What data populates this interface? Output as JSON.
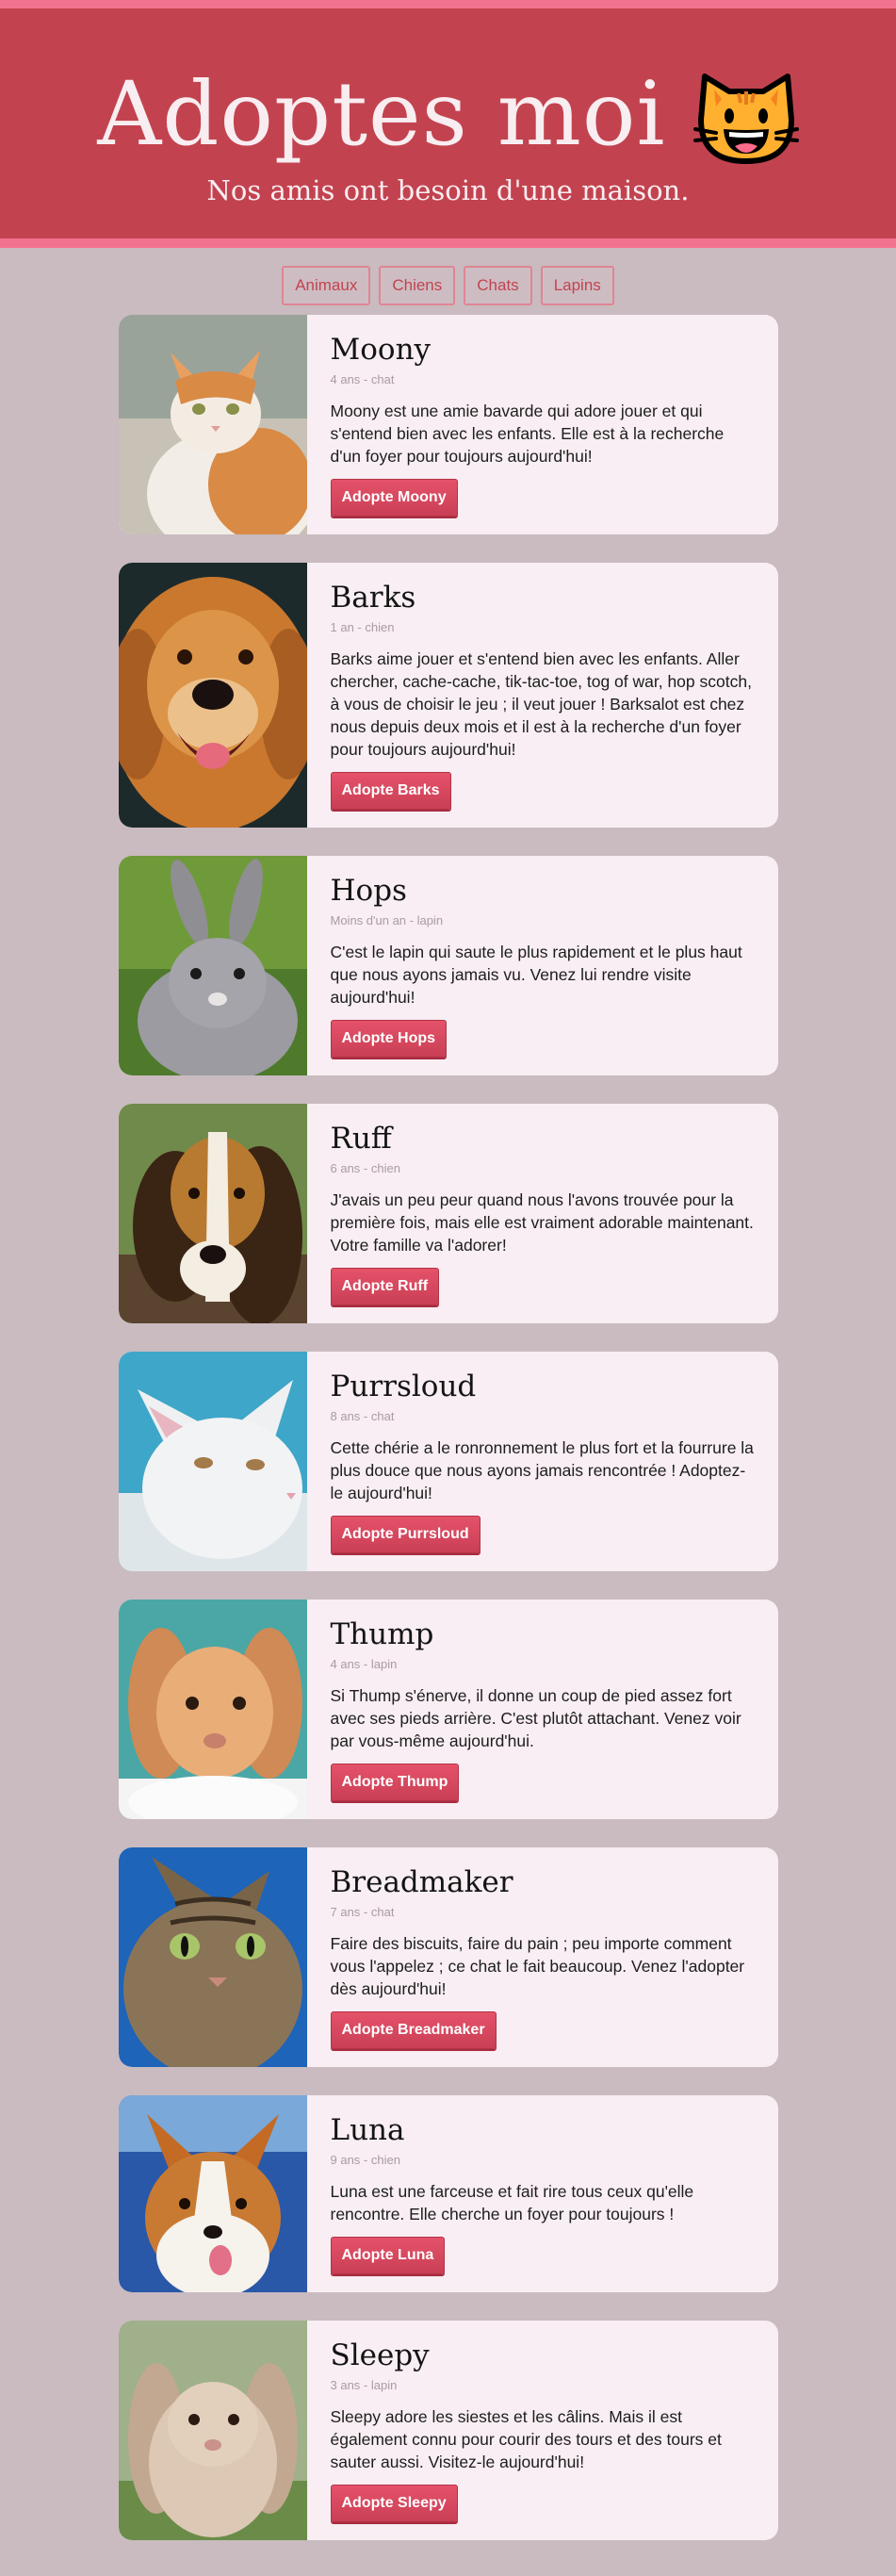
{
  "header": {
    "title": "Adoptes moi",
    "subtitle": "Nos amis ont besoin d'une maison.",
    "emoji_icon": "smiling-cat-face-icon"
  },
  "colors": {
    "header_bg": "#c2434f",
    "accent": "#f27390",
    "page_bg": "#c9bbc0",
    "card_bg": "#f8eef3",
    "button": "#d9485f"
  },
  "nav": [
    "Animaux",
    "Chiens",
    "Chats",
    "Lapins"
  ],
  "pets": [
    {
      "name": "Moony",
      "meta": "4 ans - chat",
      "description": "Moony est une amie bavarde qui adore jouer et qui s'entend bien avec les enfants. Elle est à la recherche d'un foyer pour toujours aujourd'hui!",
      "button": "Adopte Moony",
      "photo": "orange-white-cat"
    },
    {
      "name": "Barks",
      "meta": "1 an - chien",
      "description": "Barks aime jouer et s'entend bien avec les enfants. Aller chercher, cache-cache, tik-tac-toe, tog of war, hop scotch, à vous de choisir le jeu ; il veut jouer ! Barksalot est chez nous depuis deux mois et il est à la recherche d'un foyer pour toujours aujourd'hui!",
      "button": "Adopte Barks",
      "photo": "golden-retriever"
    },
    {
      "name": "Hops",
      "meta": "Moins d'un an - lapin",
      "description": "C'est le lapin qui saute le plus rapidement et le plus haut que nous ayons jamais vu. Venez lui rendre visite aujourd'hui!",
      "button": "Adopte Hops",
      "photo": "grey-rabbit"
    },
    {
      "name": "Ruff",
      "meta": "6 ans - chien",
      "description": "J'avais un peu peur quand nous l'avons trouvée pour la première fois, mais elle est vraiment adorable maintenant. Votre famille va l'adorer!",
      "button": "Adopte Ruff",
      "photo": "basset-hound"
    },
    {
      "name": "Purrsloud",
      "meta": "8 ans - chat",
      "description": "Cette chérie a le ronronnement le plus fort et la fourrure la plus douce que nous ayons jamais rencontrée ! Adoptez-le aujourd'hui!",
      "button": "Adopte Purrsloud",
      "photo": "white-cat"
    },
    {
      "name": "Thump",
      "meta": "4 ans - lapin",
      "description": "Si Thump s'énerve, il donne un coup de pied assez fort avec ses pieds arrière. C'est plutôt attachant. Venez voir par vous-même aujourd'hui.",
      "button": "Adopte Thump",
      "photo": "orange-rabbit"
    },
    {
      "name": "Breadmaker",
      "meta": "7 ans - chat",
      "description": "Faire des biscuits, faire du pain ; peu importe comment vous l'appelez ; ce chat le fait beaucoup. Venez l'adopter dès aujourd'hui!",
      "button": "Adopte Breadmaker",
      "photo": "tabby-cat"
    },
    {
      "name": "Luna",
      "meta": "9 ans - chien",
      "description": "Luna est une farceuse et fait rire tous ceux qu'elle rencontre. Elle cherche un foyer pour toujours !",
      "button": "Adopte Luna",
      "photo": "corgi"
    },
    {
      "name": "Sleepy",
      "meta": "3 ans - lapin",
      "description": "Sleepy adore les siestes et les câlins. Mais il est également connu pour courir des tours et des tours et sauter aussi. Visitez-le aujourd'hui!",
      "button": "Adopte Sleepy",
      "photo": "lop-rabbit"
    }
  ]
}
